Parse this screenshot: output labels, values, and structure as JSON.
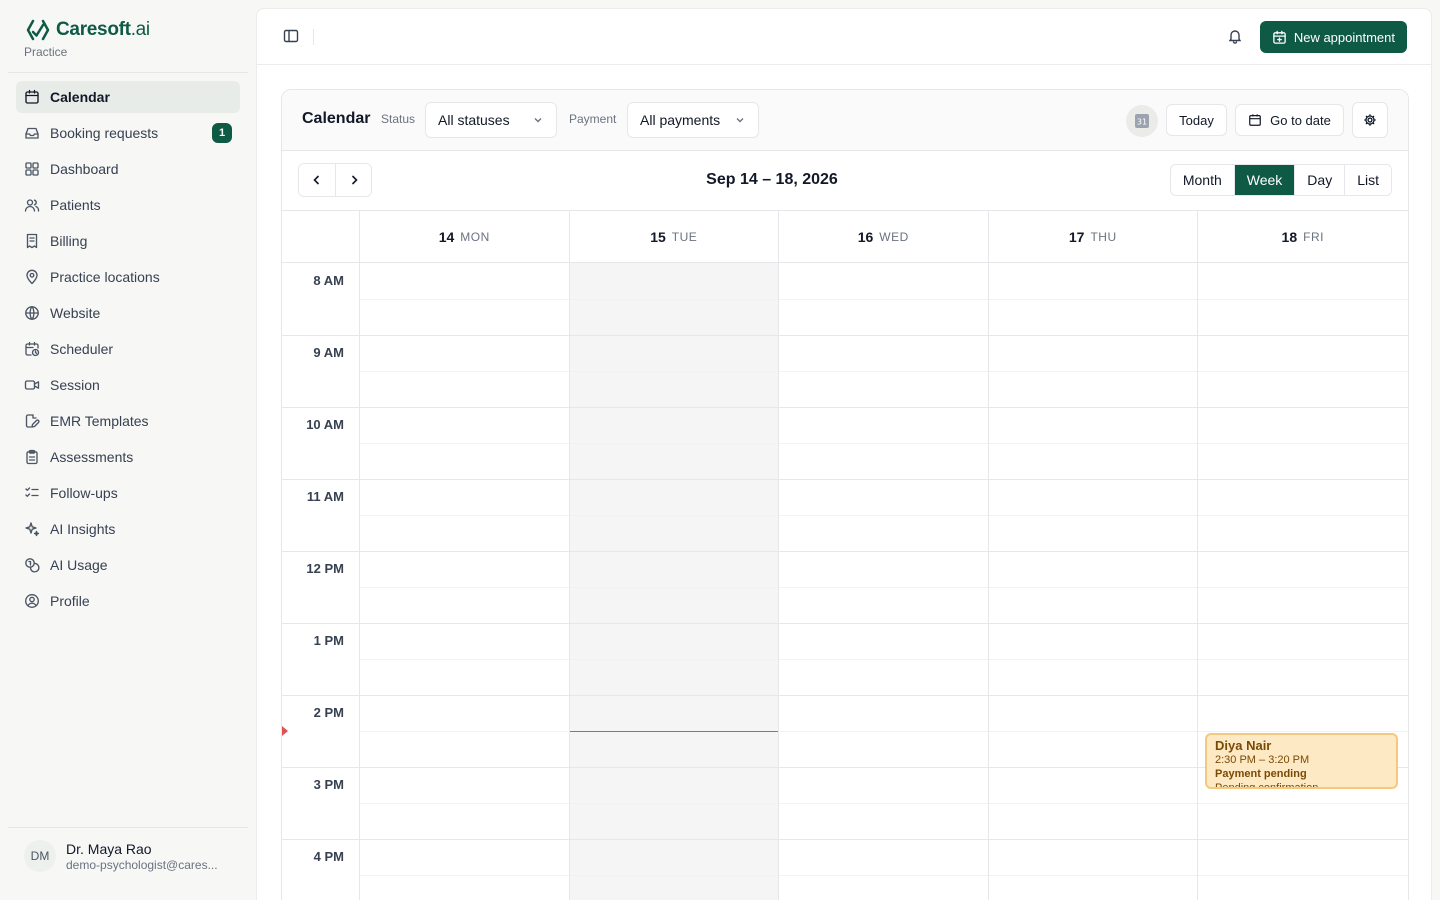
{
  "brand": {
    "name": "Caresoft",
    "suffix": ".ai",
    "subtitle": "Practice"
  },
  "sidebar": {
    "items": [
      {
        "label": "Calendar",
        "icon": "calendar-icon",
        "active": true
      },
      {
        "label": "Booking requests",
        "icon": "inbox-icon",
        "badge": "1"
      },
      {
        "label": "Dashboard",
        "icon": "dashboard-icon"
      },
      {
        "label": "Patients",
        "icon": "users-icon"
      },
      {
        "label": "Billing",
        "icon": "receipt-icon"
      },
      {
        "label": "Practice locations",
        "icon": "map-pin-icon"
      },
      {
        "label": "Website",
        "icon": "globe-icon"
      },
      {
        "label": "Scheduler",
        "icon": "calendar-clock-icon"
      },
      {
        "label": "Session",
        "icon": "video-icon"
      },
      {
        "label": "EMR Templates",
        "icon": "file-edit-icon"
      },
      {
        "label": "Assessments",
        "icon": "clipboard-icon"
      },
      {
        "label": "Follow-ups",
        "icon": "list-checks-icon"
      },
      {
        "label": "AI Insights",
        "icon": "sparkles-icon"
      },
      {
        "label": "AI Usage",
        "icon": "coins-icon"
      },
      {
        "label": "Profile",
        "icon": "user-circle-icon"
      }
    ]
  },
  "user": {
    "initials": "DM",
    "name": "Dr. Maya Rao",
    "email": "demo-psychologist@cares..."
  },
  "topbar": {
    "new_appointment": "New appointment"
  },
  "calendar": {
    "title": "Calendar",
    "status_label": "Status",
    "status_value": "All statuses",
    "payment_label": "Payment",
    "payment_value": "All payments",
    "gcal_label": "31",
    "today": "Today",
    "go_to_date": "Go to date",
    "range": "Sep 14 – 18, 2026",
    "views": [
      "Month",
      "Week",
      "Day",
      "List"
    ],
    "active_view": "Week",
    "days": [
      {
        "num": "14",
        "dow": "MON"
      },
      {
        "num": "15",
        "dow": "TUE",
        "today": true
      },
      {
        "num": "16",
        "dow": "WED"
      },
      {
        "num": "17",
        "dow": "THU"
      },
      {
        "num": "18",
        "dow": "FRI"
      }
    ],
    "hours": [
      "8 AM",
      "9 AM",
      "10 AM",
      "11 AM",
      "12 PM",
      "1 PM",
      "2 PM",
      "3 PM",
      "4 PM"
    ],
    "event": {
      "name": "Diya Nair",
      "time": "2:30 PM – 3:20 PM",
      "payment": "Payment pending",
      "status": "Pending confirmation"
    }
  },
  "colors": {
    "brand": "#0f5a45",
    "event_bg": "#fde9c4",
    "event_border": "#f2c97f",
    "now_line": "#e05252"
  }
}
